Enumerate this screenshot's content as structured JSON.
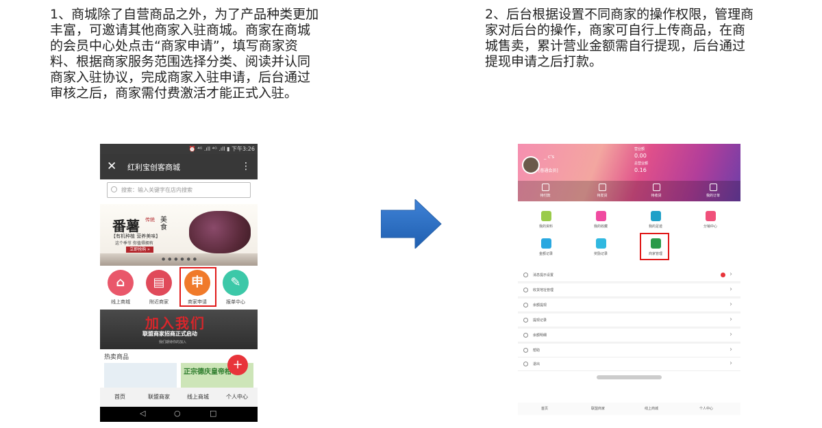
{
  "desc1": "1、商城除了自营商品之外，为了产品种类更加\n丰富，可邀请其他商家入驻商城。商家在商城\n的会员中心处点击“商家申请”，填写商家资\n料、根据商家服务范围选择分类、阅读并认同\n商家入驻协议，完成商家入驻申请，后台通过\n审核之后，商家需付费激活才能正式入驻。",
  "desc2": "2、后台根据设置不同商家的操作权限，管理商\n家对后台的操作，商家可自行上传商品，在商\n城售卖，累计营业金额需自行提现，后台通过\n提现申请之后打款。",
  "phone1": {
    "status": "⏰ ⁴ᴳ .ıll ⁴ᴳ .ıll ▮ 下午3:26",
    "title": "红利宝创客商城",
    "close": "✕",
    "more": "⋮",
    "search_placeholder": "搜索：输入关键字在店内搜索",
    "banner": {
      "big": "番薯",
      "tag": "传统",
      "tag_sub": "Traditional cuisine",
      "tag2": "美\n食",
      "sub": "【有机种植  营养美味】",
      "sub2": "这个季节  你值得拥有",
      "btn": "立即抢购 »"
    },
    "icons": [
      {
        "label": "线上商城",
        "glyph": "⌂",
        "color": "#e9576a"
      },
      {
        "label": "附近商家",
        "glyph": "▤",
        "color": "#e04a5a"
      },
      {
        "label": "商家申请",
        "glyph": "申",
        "color": "#f07a2a"
      },
      {
        "label": "报单中心",
        "glyph": "✎",
        "color": "#3cc8a8"
      }
    ],
    "join": {
      "title": "加入我们",
      "sub": "联盟商家招商正式启动",
      "sub2": "我们期待你的加入"
    },
    "hot": "热卖商品",
    "fab": "+",
    "card2_text": "正宗德庆皇帝柑",
    "nav": [
      "首页",
      "联盟商家",
      "线上商城",
      "个人中心"
    ],
    "sys": [
      "◁",
      "○",
      "□"
    ]
  },
  "phone2": {
    "name": "_ c's",
    "member": "[普通会员]",
    "stats": [
      {
        "k": "营业额",
        "v": ""
      },
      {
        "k": "",
        "v": "0.00"
      },
      {
        "k": "总营业额",
        "v": ""
      },
      {
        "k": "",
        "v": "0.16"
      }
    ],
    "tabs": [
      "待付款",
      "待发货",
      "待收货",
      "我的订单"
    ],
    "grid": [
      {
        "label": "我的资料",
        "color": "#9acb4a"
      },
      {
        "label": "我的收藏",
        "color": "#f04aa0"
      },
      {
        "label": "我的足迹",
        "color": "#1fa0c8"
      },
      {
        "label": "分销中心",
        "color": "#f0507a"
      },
      {
        "label": "金额记录",
        "color": "#2aa8e0"
      },
      {
        "label": "奖励记录",
        "color": "#30b8e0"
      },
      {
        "label": "商家管理",
        "color": "#2a9a4a"
      }
    ],
    "list": [
      "消息提示设置",
      "收货地址管理",
      "余额提现",
      "提现记录",
      "余额明细",
      "帮助",
      "退出"
    ],
    "nav": [
      "首页",
      "联盟商家",
      "线上商城",
      "个人中心"
    ]
  }
}
